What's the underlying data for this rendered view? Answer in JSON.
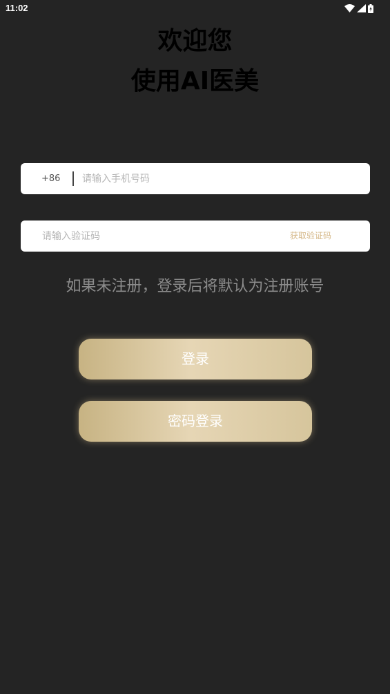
{
  "status_bar": {
    "time": "11:02",
    "icons": [
      "wifi-icon",
      "cellular-signal-icon",
      "battery-charging-icon"
    ]
  },
  "header": {
    "line1": "欢迎您",
    "line2": "使用AI医美"
  },
  "phone_field": {
    "prefix": "+86",
    "placeholder": "请输入手机号码",
    "value": ""
  },
  "code_field": {
    "placeholder": "请输入验证码",
    "value": "",
    "get_code_label": "获取验证码"
  },
  "hint": "如果未注册，登录后将默认为注册账号",
  "buttons": {
    "login": "登录",
    "password_login": "密码登录"
  },
  "colors": {
    "background": "#242424",
    "accent_gold": "#d6b98a",
    "button_gradient_start": "#c7b383",
    "button_gradient_end": "#e6d6b5"
  }
}
